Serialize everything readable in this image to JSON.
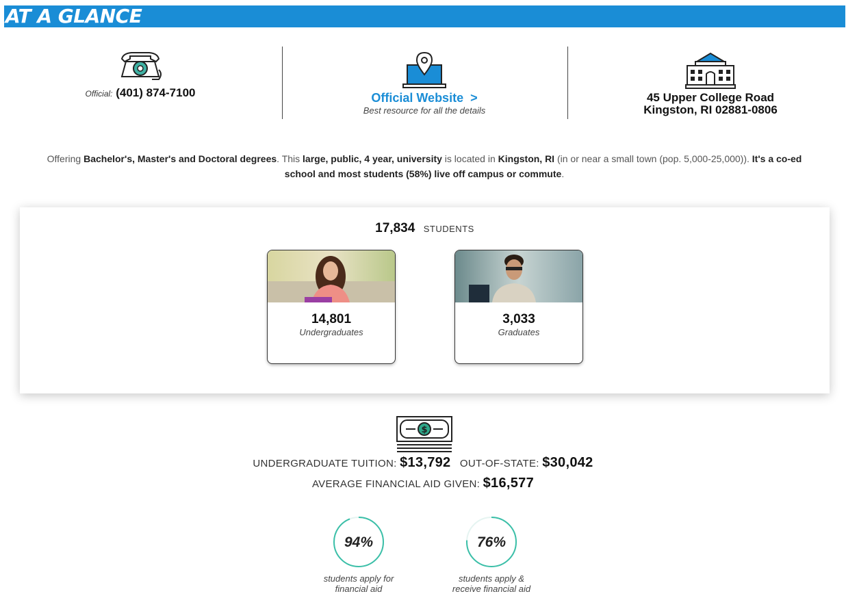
{
  "header": {
    "title": "AT A GLANCE"
  },
  "contact": {
    "phone_label": "Official:",
    "phone_number": "(401) 874-7100",
    "website_label": "Official Website",
    "website_arrow": ">",
    "website_subtitle": "Best resource for all the details",
    "address_line1": "45 Upper College Road",
    "address_line2": "Kingston, RI 02881-0806"
  },
  "description": {
    "p1": "Offering ",
    "degrees": "Bachelor's, Master's and Doctoral degrees",
    "p2": ". This ",
    "type": "large, public, 4 year, university",
    "p3": " is located in ",
    "location": "Kingston, RI",
    "p4": " (in or near a small town (pop. 5,000-25,000)). ",
    "coed": "It's a co-ed school and most students (58%) live off campus or commute",
    "p5": "."
  },
  "students": {
    "total": "17,834",
    "total_label": "STUDENTS",
    "undergrad_count": "14,801",
    "undergrad_label": "Undergraduates",
    "grad_count": "3,033",
    "grad_label": "Graduates"
  },
  "tuition": {
    "undergrad_label": "UNDERGRADUATE TUITION:",
    "undergrad_amount": "$13,792",
    "out_of_state_label": "OUT-OF-STATE:",
    "out_of_state_amount": "$30,042",
    "avg_aid_label": "AVERAGE FINANCIAL AID GIVEN:",
    "avg_aid_amount": "$16,577"
  },
  "aid_stats": [
    {
      "percent": "94%",
      "fraction": 0.94,
      "caption": "students apply for financial aid"
    },
    {
      "percent": "76%",
      "fraction": 0.76,
      "caption": "students apply & receive financial aid"
    }
  ],
  "colors": {
    "accent": "#1a8dd6",
    "ring": "#3bbfa8",
    "money_green": "#2fa88a"
  },
  "icons": [
    "telephone-icon",
    "laptop-location-icon",
    "university-building-icon",
    "money-bill-icon"
  ]
}
